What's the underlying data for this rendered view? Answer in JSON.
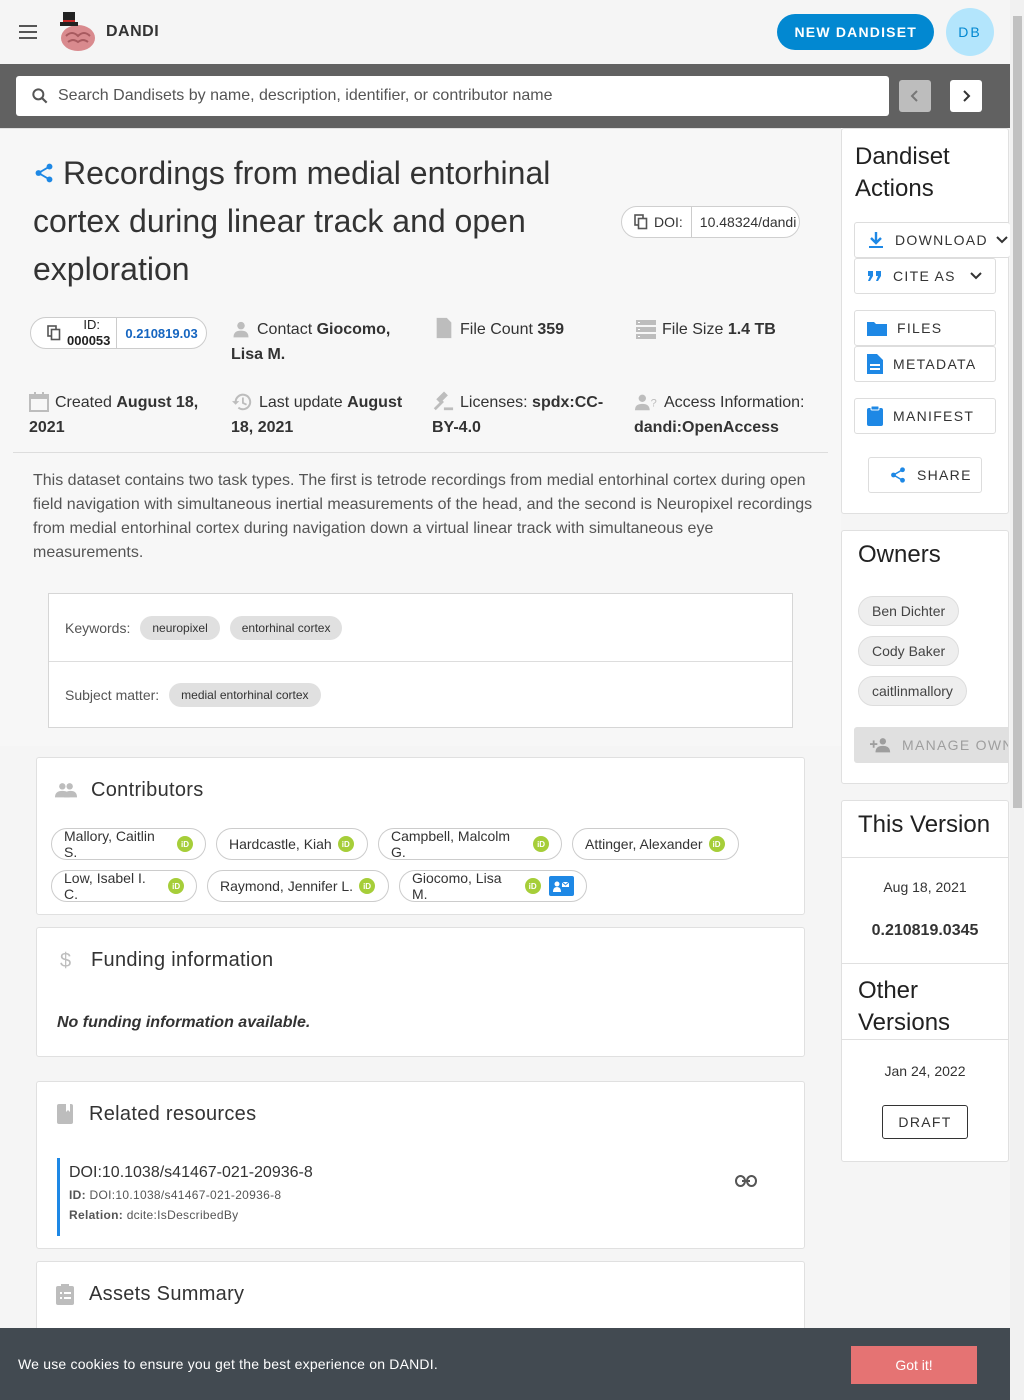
{
  "app": {
    "brand": "DANDI",
    "new_dandiset_label": "NEW DANDISET",
    "avatar_initials": "DB"
  },
  "search": {
    "placeholder": "Search Dandisets by name, description, identifier, or contributor name"
  },
  "dandiset": {
    "title": "Recordings from medial entorhinal cortex during linear track and open exploration",
    "doi_label": "DOI:",
    "doi_value": "10.48324/dandi",
    "id_label_1": "ID:",
    "id_label_2": "000053",
    "version": "0.210819.03",
    "contact_label": "Contact",
    "contact_value": "Giocomo, Lisa M.",
    "file_count_label": "File Count",
    "file_count_value": "359",
    "file_size_label": "File Size",
    "file_size_value": "1.4 TB",
    "created_label": "Created",
    "created_value": "August 18, 2021",
    "last_update_label": "Last update",
    "last_update_value": "August 18, 2021",
    "licenses_label": "Licenses:",
    "licenses_value": "spdx:CC-BY-4.0",
    "access_label": "Access Information:",
    "access_value": "dandi:OpenAccess",
    "description": "This dataset contains two task types. The first is tetrode recordings from medial entorhinal cortex during open field navigation with simultaneous inertial measurements of the head, and the second is Neuropixel recordings from medial entorhinal cortex during navigation down a virtual linear track with simultaneous eye measurements.",
    "keywords_label": "Keywords:",
    "keywords": [
      "neuropixel",
      "entorhinal cortex"
    ],
    "subject_label": "Subject matter:",
    "subjects": [
      "medial entorhinal cortex"
    ]
  },
  "contributors": {
    "title": "Contributors",
    "people": [
      "Mallory, Caitlin S.",
      "Hardcastle, Kiah",
      "Campbell, Malcolm G.",
      "Attinger, Alexander",
      "Low, Isabel I. C.",
      "Raymond, Jennifer L.",
      "Giocomo, Lisa M."
    ],
    "orcid_glyph": "iD"
  },
  "funding": {
    "title": "Funding information",
    "empty_text": "No funding information available."
  },
  "resources": {
    "title": "Related resources",
    "item_title": "DOI:10.1038/s41467-021-20936-8",
    "id_label": "ID:",
    "id_value": "DOI:10.1038/s41467-021-20936-8",
    "relation_label": "Relation:",
    "relation_value": "dcite:IsDescribedBy"
  },
  "assets": {
    "title": "Assets Summary"
  },
  "actions": {
    "title": "Dandiset Actions",
    "download": "DOWNLOAD",
    "cite_as": "CITE AS",
    "files": "FILES",
    "metadata": "METADATA",
    "manifest": "MANIFEST",
    "share": "SHARE"
  },
  "owners": {
    "title": "Owners",
    "names": [
      "Ben Dichter",
      "Cody Baker",
      "caitlinmallory"
    ],
    "manage_label": "MANAGE OWNERS"
  },
  "this_version": {
    "title": "This Version",
    "date": "Aug 18, 2021",
    "version": "0.210819.0345"
  },
  "other_versions": {
    "title": "Other Versions",
    "date": "Jan 24, 2022",
    "draft_label": "DRAFT"
  },
  "cookie": {
    "text": "We use cookies to ensure you get the best experience on DANDI.",
    "button": "Got it!"
  },
  "colors": {
    "primary": "#0288d1",
    "accent_blue": "#1e88e5",
    "orcid": "#a6ce39",
    "cookie_bg": "#424a51",
    "cookie_btn": "#e57373"
  }
}
